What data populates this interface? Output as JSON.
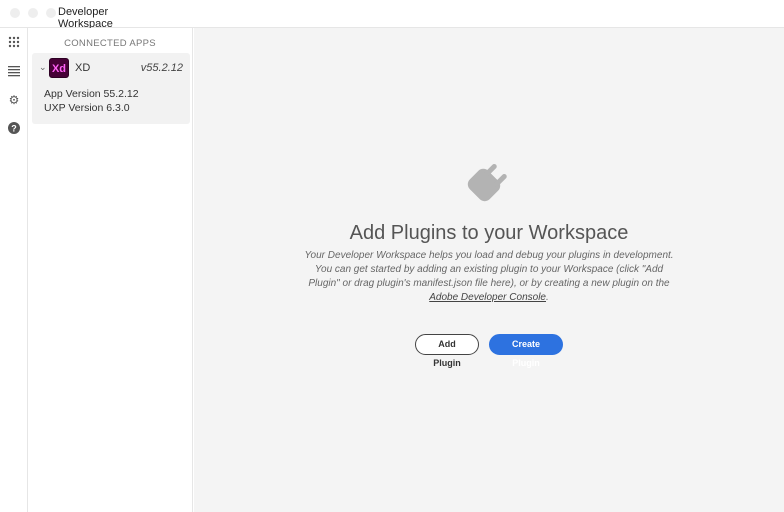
{
  "window": {
    "tab": "Developer Workspace"
  },
  "rail": {
    "icons": [
      "apps-grid-icon",
      "list-icon",
      "gear-icon",
      "help-icon"
    ]
  },
  "sidebar": {
    "heading": "CONNECTED APPS",
    "app": {
      "icon_text": "Xd",
      "name": "XD",
      "version": "v55.2.12",
      "app_version": "App Version 55.2.12",
      "uxp_version": "UXP Version 6.3.0"
    }
  },
  "main": {
    "title": "Add Plugins to your Workspace",
    "desc1": "Your Developer Workspace helps you load and debug your plugins in development.",
    "desc2": "You can get started by adding an existing plugin to your Workspace (click \"Add Plugin\" or drag plugin's manifest.json file here), or by creating a new plugin on the ",
    "link": "Adobe Developer Console",
    "desc_end": ".",
    "add_label": "Add Plugin",
    "create_label": "Create Plugin"
  },
  "colors": {
    "accent": "#2d72e0",
    "xd_bg": "#470137",
    "xd_fg": "#ff61f6"
  }
}
